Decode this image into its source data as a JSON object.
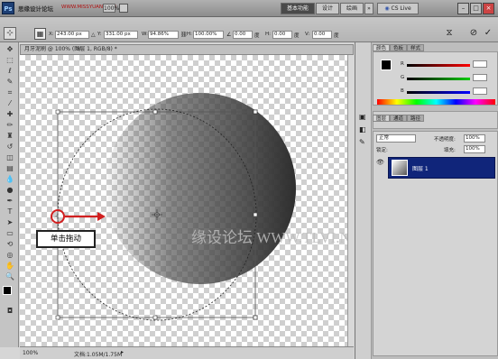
{
  "app": {
    "logo_text": "Ps"
  },
  "menubar": {
    "menu_text": "思缘设计论坛",
    "watermark_url": "WWW.MISSYUAN.COM",
    "zoom_value": "100%",
    "workspace_buttons": [
      "基本功能",
      "设计",
      "绘画"
    ],
    "cs_live": "CS Live",
    "window_controls": [
      "minimize-icon",
      "maximize-icon",
      "close-icon"
    ]
  },
  "options_bar": {
    "x_label": "X:",
    "x_value": "243.00 px",
    "y_label": "Y:",
    "y_value": "331.00 px",
    "w_label": "W:",
    "w_value": "94.86%",
    "h_label": "H:",
    "h_value": "100.00%",
    "angle_value": "0.00",
    "angle_unit": "度",
    "hskew_label": "H:",
    "hskew_value": "0.00",
    "hskew_unit": "度",
    "vskew_label": "V:",
    "vskew_value": "0.00",
    "vskew_unit": "度"
  },
  "document": {
    "tab_title": "月牙泥刷 @ 100% (图层 1, RGB/8) *",
    "zoom": "100%",
    "doc_info": "文档:1.05M/1.75M",
    "watermark": "缘设论坛 WWW.TLVI.NET"
  },
  "annotation": {
    "callout_text": "单击拖动"
  },
  "panels": {
    "color_tabs": [
      "颜色",
      "色板",
      "样式"
    ],
    "color_labels": [
      "R",
      "G",
      "B"
    ],
    "layers_tabs": [
      "图层",
      "通道",
      "路径"
    ],
    "blend_mode": "正常",
    "opacity_label": "不透明度:",
    "opacity_value": "100%",
    "lock_label": "锁定:",
    "fill_label": "填充:",
    "fill_value": "100%",
    "layer_name": "图层 1"
  },
  "colors": {
    "accent": "#10257a",
    "arrow": "#d11f1f"
  }
}
